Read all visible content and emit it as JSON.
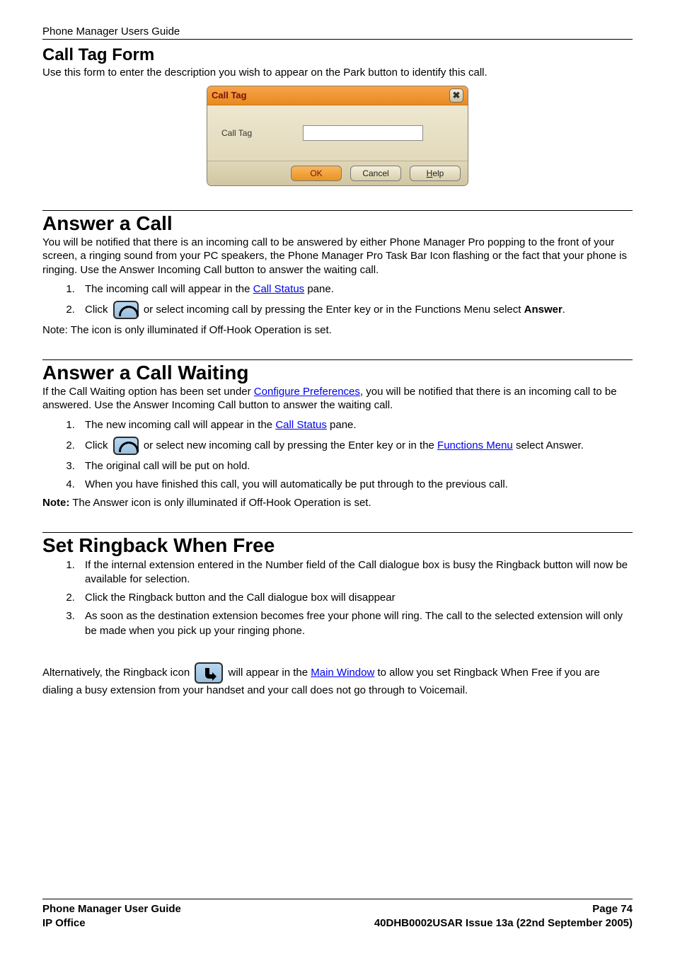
{
  "header": {
    "doc_title": "Phone Manager Users Guide"
  },
  "section1": {
    "heading": "Call Tag Form",
    "intro": "Use this form to enter the description you wish to appear on the Park button to identify this call.",
    "dialog": {
      "title": "Call Tag",
      "close_glyph": "✖",
      "field_label": "Call Tag",
      "ok_label": "OK",
      "cancel_label": "Cancel",
      "help_label": "Help",
      "help_underline": "H"
    }
  },
  "section2": {
    "heading": "Answer a Call",
    "intro": "You will be notified that there is an incoming call to be answered by either Phone Manager Pro popping to the front of your screen, a ringing sound from your PC speakers, the Phone Manager Pro Task Bar Icon flashing or the fact that your phone is ringing. Use the Answer Incoming Call button to answer the waiting call.",
    "step1_pre": "The incoming call will appear in the ",
    "step1_link": "Call Status",
    "step1_post": " pane.",
    "step2_pre": "Click ",
    "step2_mid": " or select incoming call by pressing the Enter key or in the Functions Menu select ",
    "step2_bold": "Answer",
    "step2_end": ".",
    "note": "Note: The icon is only illuminated if Off-Hook Operation is set."
  },
  "section3": {
    "heading": " Answer a Call Waiting",
    "intro_pre": "If the Call Waiting option has been set under ",
    "intro_link": "Configure Preferences",
    "intro_post": ", you will be notified that there is an incoming call to be answered. Use the Answer Incoming Call button to answer the waiting call.",
    "step1_pre": "The new incoming call will appear in the ",
    "step1_link": "Call Status",
    "step1_post": " pane.",
    "step2_pre": "Click ",
    "step2_mid": " or select new incoming call by pressing the Enter key or in the ",
    "step2_link": "Functions Menu",
    "step2_post": " select Answer.",
    "step3": "The original call will be put on hold.",
    "step4": "When you have finished this call, you will automatically be put through to the previous call.",
    "note_label": "Note:",
    "note_text": " The Answer icon is only illuminated if Off-Hook Operation is set."
  },
  "section4": {
    "heading": "Set Ringback When Free",
    "step1": "If the internal extension entered in the Number field of the Call dialogue box is busy the Ringback button will now be available for selection.",
    "step2": "Click the Ringback button and the Call dialogue box will disappear",
    "step3": "As soon as the destination extension becomes free your phone will ring. The call to the selected extension will only be made when you pick up your ringing phone.",
    "alt_pre": "Alternatively, the Ringback icon ",
    "alt_mid": " will appear in the ",
    "alt_link": "Main Window",
    "alt_post": " to allow you set Ringback When Free if you are dialing a busy extension from your handset and your call does not go through to Voicemail."
  },
  "footer": {
    "left1": "Phone Manager User Guide",
    "left2": "IP Office",
    "right1": "Page 74",
    "right2": "40DHB0002USAR Issue 13a (22nd September 2005)"
  }
}
